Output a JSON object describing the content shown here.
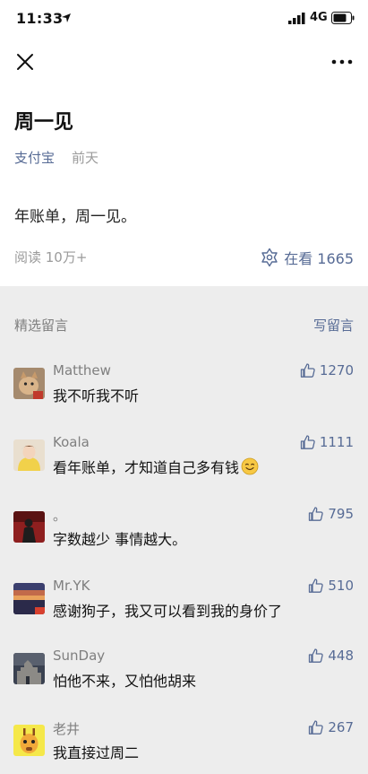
{
  "status_bar": {
    "time": "11:33",
    "network": "4G"
  },
  "article": {
    "title": "周一见",
    "account": "支付宝",
    "date": "前天",
    "body": "年账单，周一见。",
    "reads": "阅读 10万+",
    "looking_label": "在看 1665"
  },
  "comments_section": {
    "title": "精选留言",
    "write_label": "写留言"
  },
  "comments": [
    {
      "name": "Matthew",
      "text": "我不听我不听",
      "likes": "1270",
      "avatar": "cat-avatar"
    },
    {
      "name": "Koala",
      "text": "看年账单，才知道自己多有钱",
      "likes": "1111",
      "avatar": "girl-avatar",
      "emoji": "smile-emoji"
    },
    {
      "name": "。",
      "text": "字数越少 事情越大。",
      "likes": "795",
      "avatar": "dark-figure-avatar"
    },
    {
      "name": "Mr.YK",
      "text": "感谢狗子，我又可以看到我的身价了",
      "likes": "510",
      "avatar": "sunset-avatar"
    },
    {
      "name": "SunDay",
      "text": "怕他不来，又怕他胡来",
      "likes": "448",
      "avatar": "castle-avatar"
    },
    {
      "name": "老井",
      "text": "我直接过周二",
      "likes": "267",
      "avatar": "giraffe-avatar"
    }
  ],
  "colors": {
    "link": "#576b95",
    "muted": "#9b9b9b",
    "background": "#ededed"
  }
}
